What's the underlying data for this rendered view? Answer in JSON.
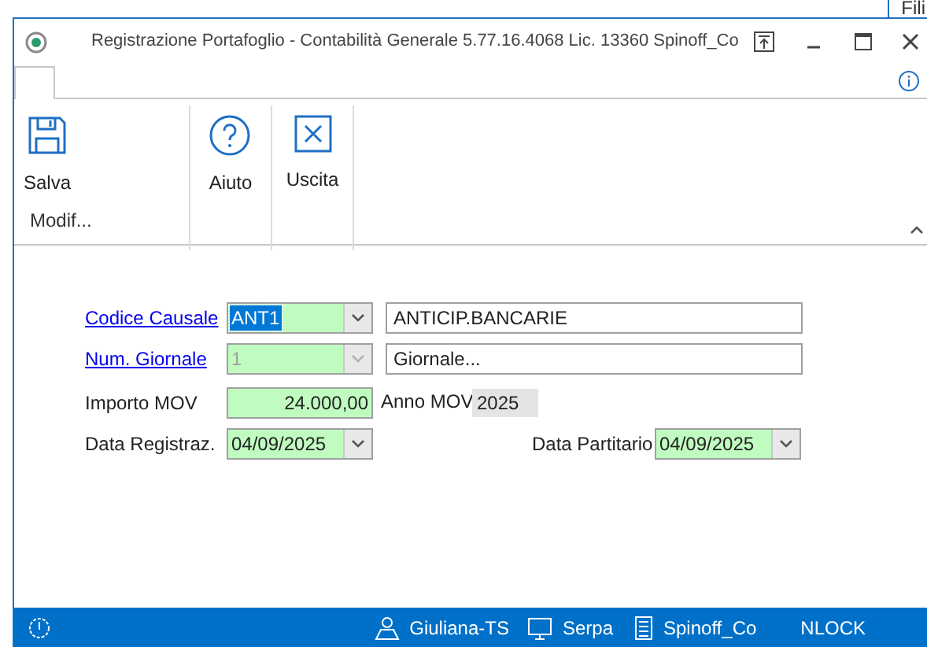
{
  "background_text": "Fili",
  "window": {
    "title": "Registrazione Portafoglio - Contabilità Generale 5.77.16.4068 Lic. 13360 Spinoff_Co"
  },
  "ribbon": {
    "groups": [
      {
        "label": "Modif...",
        "buttons": [
          {
            "kind": "save",
            "label": "Salva"
          }
        ]
      },
      {
        "buttons": [
          {
            "kind": "help",
            "label": "Aiuto"
          }
        ]
      },
      {
        "buttons": [
          {
            "kind": "exit",
            "label": "Uscita"
          }
        ]
      }
    ]
  },
  "form": {
    "codice_causale": {
      "label": "Codice Causale",
      "value": "ANT1",
      "focused": true,
      "disabled": false,
      "description": "ANTICIP.BANCARIE"
    },
    "num_giornale": {
      "label": "Num. Giornale",
      "value": "1",
      "focused": false,
      "disabled": true,
      "description": "Giornale..."
    },
    "importo_mov": {
      "label": "Importo MOV",
      "value": "24.000,00"
    },
    "anno_mov": {
      "label": "Anno MOV",
      "value": "2025"
    },
    "data_registraz": {
      "label": "Data Registraz.",
      "value": "04/09/2025",
      "focused": false,
      "disabled": false
    },
    "data_partitario": {
      "label": "Data Partitario",
      "value": "04/09/2025",
      "focused": false,
      "disabled": false
    }
  },
  "status_bar": {
    "items": [
      {
        "kind": "user",
        "text": "Giuliana-TS"
      },
      {
        "kind": "computer",
        "text": "Serpa"
      },
      {
        "kind": "company",
        "text": "Spinoff_Co"
      },
      {
        "kind": "plain",
        "text": "NLOCK"
      }
    ]
  }
}
